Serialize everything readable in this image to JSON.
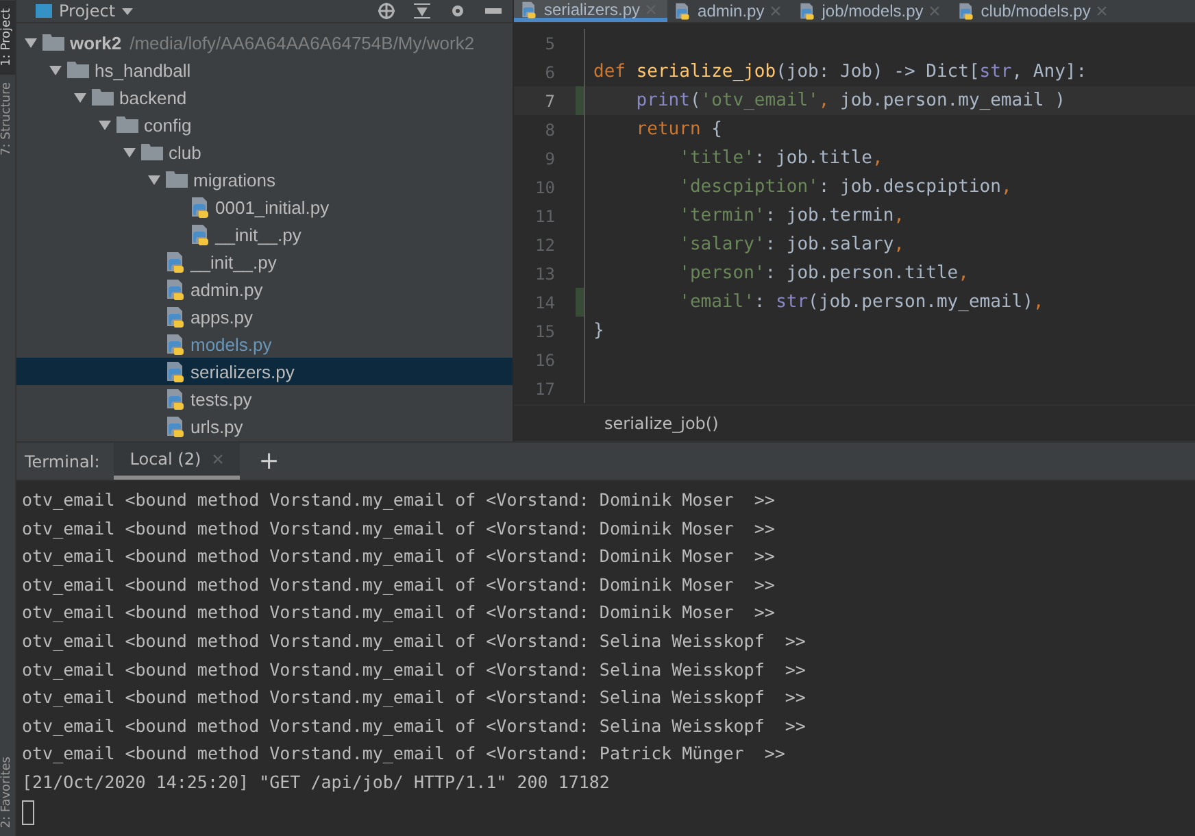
{
  "tool_strip": {
    "labels": [
      {
        "text": "1: Project",
        "selected": true
      },
      {
        "text": "7: Structure",
        "selected": false
      },
      {
        "text": "2: Favorites",
        "selected": false
      }
    ]
  },
  "project": {
    "title": "Project",
    "tree": [
      {
        "label": "work2",
        "path": "/media/lofy/AA6A64AA6A64754B/My/work2",
        "kind": "folder",
        "expanded": true,
        "selected": false,
        "modified": false,
        "children": [
          {
            "label": "hs_handball",
            "kind": "folder",
            "expanded": true,
            "selected": false,
            "modified": false,
            "children": [
              {
                "label": "backend",
                "kind": "folder",
                "expanded": true,
                "selected": false,
                "modified": false,
                "children": [
                  {
                    "label": "config",
                    "kind": "folder",
                    "expanded": true,
                    "selected": false,
                    "modified": false,
                    "children": [
                      {
                        "label": "club",
                        "kind": "folder",
                        "expanded": true,
                        "selected": false,
                        "modified": false,
                        "children": [
                          {
                            "label": "migrations",
                            "kind": "folder",
                            "expanded": true,
                            "selected": false,
                            "modified": false,
                            "children": [
                              {
                                "label": "0001_initial.py",
                                "kind": "python",
                                "selected": false,
                                "modified": false
                              },
                              {
                                "label": "__init__.py",
                                "kind": "python",
                                "selected": false,
                                "modified": false
                              }
                            ]
                          },
                          {
                            "label": "__init__.py",
                            "kind": "python",
                            "selected": false,
                            "modified": false
                          },
                          {
                            "label": "admin.py",
                            "kind": "python",
                            "selected": false,
                            "modified": false
                          },
                          {
                            "label": "apps.py",
                            "kind": "python",
                            "selected": false,
                            "modified": false
                          },
                          {
                            "label": "models.py",
                            "kind": "python",
                            "selected": false,
                            "modified": true
                          },
                          {
                            "label": "serializers.py",
                            "kind": "python",
                            "selected": true,
                            "modified": false
                          },
                          {
                            "label": "tests.py",
                            "kind": "python",
                            "selected": false,
                            "modified": false
                          },
                          {
                            "label": "urls.py",
                            "kind": "python",
                            "selected": false,
                            "modified": false
                          }
                        ]
                      }
                    ]
                  }
                ]
              }
            ]
          }
        ]
      }
    ]
  },
  "editor": {
    "tabs": [
      {
        "label": "serializers.py",
        "selected": true
      },
      {
        "label": "admin.py",
        "selected": false
      },
      {
        "label": "job/models.py",
        "selected": false
      },
      {
        "label": "club/models.py",
        "selected": false
      }
    ],
    "lines": [
      {
        "number": "5",
        "current": false,
        "changed": false
      },
      {
        "number": "6",
        "current": false,
        "changed": false,
        "tokens": [
          {
            "kind": "keyword",
            "text": "def "
          },
          {
            "kind": "function",
            "text": "serialize_job"
          },
          {
            "kind": "plain",
            "text": "(job: Job) -> Dict["
          },
          {
            "kind": "builtin",
            "text": "str"
          },
          {
            "kind": "plain",
            "text": ", Any]:"
          }
        ]
      },
      {
        "number": "7",
        "current": true,
        "changed": true,
        "tokens": [
          {
            "kind": "builtin",
            "text": "    print"
          },
          {
            "kind": "plain",
            "text": "("
          },
          {
            "kind": "string",
            "text": "'otv_email'"
          },
          {
            "kind": "keyword",
            "text": ", "
          },
          {
            "kind": "plain",
            "text": "job.person.my_email "
          },
          {
            "kind": "plain",
            "text": ")"
          }
        ]
      },
      {
        "number": "8",
        "current": false,
        "changed": false,
        "tokens": [
          {
            "kind": "keyword",
            "text": "    return "
          },
          {
            "kind": "plain",
            "text": "{"
          }
        ]
      },
      {
        "number": "9",
        "current": false,
        "changed": false,
        "tokens": [
          {
            "kind": "string",
            "text": "        'title'"
          },
          {
            "kind": "plain",
            "text": ": job.title"
          },
          {
            "kind": "keyword",
            "text": ","
          }
        ]
      },
      {
        "number": "10",
        "current": false,
        "changed": false,
        "tokens": [
          {
            "kind": "string",
            "text": "        'descpiption'"
          },
          {
            "kind": "plain",
            "text": ": job.descpiption"
          },
          {
            "kind": "keyword",
            "text": ","
          }
        ]
      },
      {
        "number": "11",
        "current": false,
        "changed": false,
        "tokens": [
          {
            "kind": "string",
            "text": "        'termin'"
          },
          {
            "kind": "plain",
            "text": ": job.termin"
          },
          {
            "kind": "keyword",
            "text": ","
          }
        ]
      },
      {
        "number": "12",
        "current": false,
        "changed": false,
        "tokens": [
          {
            "kind": "string",
            "text": "        'salary'"
          },
          {
            "kind": "plain",
            "text": ": job.salary"
          },
          {
            "kind": "keyword",
            "text": ","
          }
        ]
      },
      {
        "number": "13",
        "current": false,
        "changed": false,
        "tokens": [
          {
            "kind": "string",
            "text": "        'person'"
          },
          {
            "kind": "plain",
            "text": ": job.person.title"
          },
          {
            "kind": "keyword",
            "text": ","
          }
        ]
      },
      {
        "number": "14",
        "current": false,
        "changed": true,
        "tokens": [
          {
            "kind": "string",
            "text": "        'email'"
          },
          {
            "kind": "plain",
            "text": ": "
          },
          {
            "kind": "builtin",
            "text": "str"
          },
          {
            "kind": "plain",
            "text": "(job.person.my_email)"
          },
          {
            "kind": "keyword",
            "text": ","
          }
        ]
      },
      {
        "number": "15",
        "current": false,
        "changed": false,
        "tokens": [
          {
            "kind": "plain",
            "text": "}"
          }
        ]
      },
      {
        "number": "16",
        "current": false,
        "changed": false
      },
      {
        "number": "17",
        "current": false,
        "changed": false
      }
    ],
    "breadcrumb": "serialize_job()"
  },
  "terminal": {
    "label": "Terminal:",
    "tabs": [
      {
        "label": "Local (2)",
        "selected": true
      }
    ],
    "add": "+",
    "lines": [
      "otv_email <bound method Vorstand.my_email of <Vorstand: Dominik Moser  >>",
      "otv_email <bound method Vorstand.my_email of <Vorstand: Dominik Moser  >>",
      "otv_email <bound method Vorstand.my_email of <Vorstand: Dominik Moser  >>",
      "otv_email <bound method Vorstand.my_email of <Vorstand: Dominik Moser  >>",
      "otv_email <bound method Vorstand.my_email of <Vorstand: Dominik Moser  >>",
      "otv_email <bound method Vorstand.my_email of <Vorstand: Selina Weisskopf  >>",
      "otv_email <bound method Vorstand.my_email of <Vorstand: Selina Weisskopf  >>",
      "otv_email <bound method Vorstand.my_email of <Vorstand: Selina Weisskopf  >>",
      "otv_email <bound method Vorstand.my_email of <Vorstand: Selina Weisskopf  >>",
      "otv_email <bound method Vorstand.my_email of <Vorstand: Patrick Münger  >>",
      "[21/Oct/2020 14:25:20] \"GET /api/job/ HTTP/1.1\" 200 17182"
    ]
  }
}
